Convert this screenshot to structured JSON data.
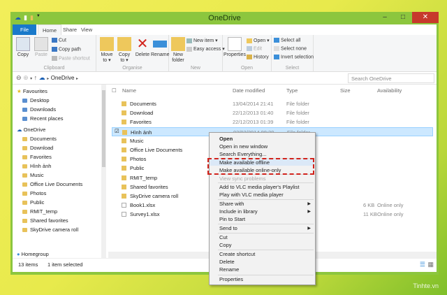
{
  "window": {
    "title": "OneDrive"
  },
  "tabs": [
    "File",
    "Home",
    "Share",
    "View"
  ],
  "ribbon": {
    "clipboard": {
      "label": "Clipboard",
      "copy": "Copy",
      "paste": "Paste",
      "cut": "Cut",
      "copy_path": "Copy path",
      "paste_shortcut": "Paste shortcut"
    },
    "organise": {
      "label": "Organise",
      "move_to": "Move to ▾",
      "copy_to": "Copy to ▾",
      "delete": "Delete",
      "rename": "Rename"
    },
    "new": {
      "label": "New",
      "new_folder": "New folder",
      "new_item": "New item ▾",
      "easy_access": "Easy access ▾"
    },
    "open": {
      "label": "Open",
      "properties": "Properties",
      "open": "Open ▾",
      "edit": "Edit",
      "history": "History"
    },
    "select": {
      "label": "Select",
      "select_all": "Select all",
      "select_none": "Select none",
      "invert": "Invert selection"
    }
  },
  "address": {
    "path": "OneDrive",
    "search_placeholder": "Search OneDrive"
  },
  "sidebar": {
    "favourites": "Favourites",
    "fav_items": [
      "Desktop",
      "Downloads",
      "Recent places"
    ],
    "onedrive": "OneDrive",
    "od_items": [
      "Documents",
      "Download",
      "Favorites",
      "Hình ảnh",
      "Music",
      "Office Live Documents",
      "Photos",
      "Public",
      "RMIT_temp",
      "Shared favorites",
      "SkyDrive camera roll"
    ],
    "homegroup": "Homegroup"
  },
  "columns": [
    "Name",
    "Date modified",
    "Type",
    "Size",
    "Availability"
  ],
  "files": [
    {
      "name": "Documents",
      "date": "13/04/2014 21:41",
      "type": "File folder",
      "size": "",
      "avail": ""
    },
    {
      "name": "Download",
      "date": "22/12/2013 01:40",
      "type": "File folder",
      "size": "",
      "avail": ""
    },
    {
      "name": "Favorites",
      "date": "22/12/2013 01:39",
      "type": "File folder",
      "size": "",
      "avail": ""
    },
    {
      "name": "Hình ảnh",
      "date": "02/03/2014 08:29",
      "type": "File folder",
      "size": "",
      "avail": ""
    },
    {
      "name": "Music",
      "date": "",
      "type": "",
      "size": "",
      "avail": ""
    },
    {
      "name": "Office Live Documents",
      "date": "",
      "type": "",
      "size": "",
      "avail": ""
    },
    {
      "name": "Photos",
      "date": "",
      "type": "",
      "size": "",
      "avail": ""
    },
    {
      "name": "Public",
      "date": "",
      "type": "",
      "size": "",
      "avail": ""
    },
    {
      "name": "RMIT_temp",
      "date": "",
      "type": "",
      "size": "",
      "avail": ""
    },
    {
      "name": "Shared favorites",
      "date": "",
      "type": "",
      "size": "",
      "avail": ""
    },
    {
      "name": "SkyDrive camera roll",
      "date": "",
      "type": "",
      "size": "",
      "avail": ""
    },
    {
      "name": "Book1.xlsx",
      "date": "",
      "type": "",
      "size": "6 KB",
      "avail": "Online only"
    },
    {
      "name": "Survey1.xlsx",
      "date": "",
      "type": "",
      "size": "11 KB",
      "avail": "Online only"
    }
  ],
  "status": {
    "count": "13 items",
    "selected": "1 item selected"
  },
  "context_menu": [
    "Open",
    "Open in new window",
    "Search Everything...",
    "Make available offline",
    "Make available online-only",
    "View sync problems",
    "Add to VLC media player's Playlist",
    "Play with VLC media player",
    "Share with",
    "Include in library",
    "Pin to Start",
    "Send to",
    "Cut",
    "Copy",
    "Create shortcut",
    "Delete",
    "Rename",
    "Properties"
  ],
  "watermark": "Tinhte.vn"
}
